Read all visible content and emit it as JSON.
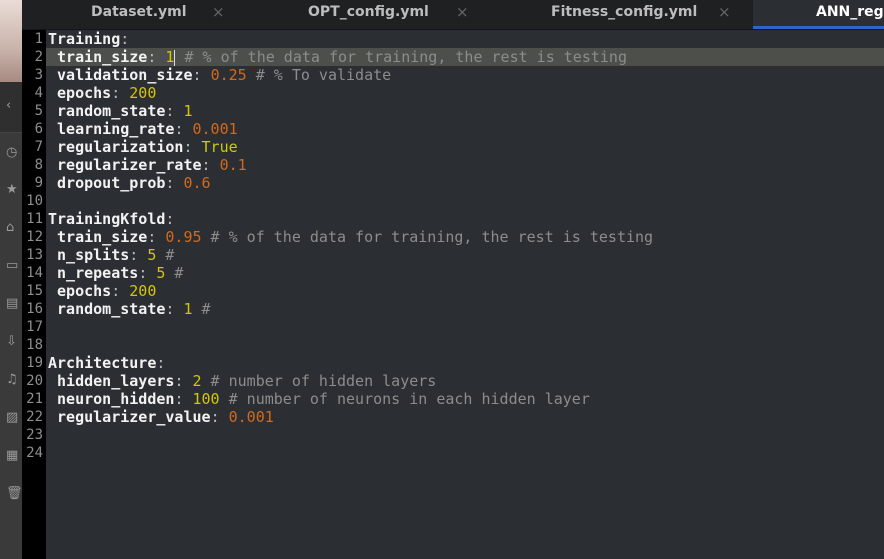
{
  "tabs": [
    {
      "label": "Dataset.yml",
      "active": false
    },
    {
      "label": "OPT_config.yml",
      "active": false
    },
    {
      "label": "Fitness_config.yml",
      "active": false
    },
    {
      "label": "ANN_reg.yml",
      "active": true
    }
  ],
  "close_glyph": "×",
  "line_numbers": [
    "1",
    "2",
    "3",
    "4",
    "5",
    "6",
    "7",
    "8",
    "9",
    "10",
    "11",
    "12",
    "13",
    "14",
    "15",
    "16",
    "17",
    "18",
    "19",
    "20",
    "21",
    "22",
    "23",
    "24"
  ],
  "lines": [
    {
      "indent": "",
      "key": "Training",
      "sep": ":",
      "val": "",
      "vt": "",
      "comment": ""
    },
    {
      "indent": " ",
      "key": "train_size",
      "sep": ": ",
      "val": "1",
      "vt": "i",
      "comment": " # % of the data for training, the rest is testing",
      "current": true
    },
    {
      "indent": " ",
      "key": "validation_size",
      "sep": ": ",
      "val": "0.25",
      "vt": "f",
      "comment": " # % To validate"
    },
    {
      "indent": " ",
      "key": "epochs",
      "sep": ": ",
      "val": "200",
      "vt": "i",
      "comment": ""
    },
    {
      "indent": " ",
      "key": "random_state",
      "sep": ": ",
      "val": "1",
      "vt": "i",
      "comment": ""
    },
    {
      "indent": " ",
      "key": "learning_rate",
      "sep": ": ",
      "val": "0.001",
      "vt": "f",
      "comment": ""
    },
    {
      "indent": " ",
      "key": "regularization",
      "sep": ": ",
      "val": "True",
      "vt": "b",
      "comment": ""
    },
    {
      "indent": " ",
      "key": "regularizer_rate",
      "sep": ": ",
      "val": "0.1",
      "vt": "f",
      "comment": ""
    },
    {
      "indent": " ",
      "key": "dropout_prob",
      "sep": ": ",
      "val": "0.6",
      "vt": "f",
      "comment": ""
    },
    {
      "indent": "",
      "key": "",
      "sep": "",
      "val": "",
      "vt": "",
      "comment": ""
    },
    {
      "indent": "",
      "key": "TrainingKfold",
      "sep": ":",
      "val": "",
      "vt": "",
      "comment": ""
    },
    {
      "indent": " ",
      "key": "train_size",
      "sep": ": ",
      "val": "0.95",
      "vt": "f",
      "comment": " # % of the data for training, the rest is testing"
    },
    {
      "indent": " ",
      "key": "n_splits",
      "sep": ": ",
      "val": "5",
      "vt": "i",
      "comment": " #"
    },
    {
      "indent": " ",
      "key": "n_repeats",
      "sep": ": ",
      "val": "5",
      "vt": "i",
      "comment": " #"
    },
    {
      "indent": " ",
      "key": "epochs",
      "sep": ": ",
      "val": "200",
      "vt": "i",
      "comment": ""
    },
    {
      "indent": " ",
      "key": "random_state",
      "sep": ": ",
      "val": "1",
      "vt": "i",
      "comment": " #"
    },
    {
      "indent": "",
      "key": "",
      "sep": "",
      "val": "",
      "vt": "",
      "comment": ""
    },
    {
      "indent": "",
      "key": "",
      "sep": "",
      "val": "",
      "vt": "",
      "comment": ""
    },
    {
      "indent": "",
      "key": "Architecture",
      "sep": ":",
      "val": "",
      "vt": "",
      "comment": ""
    },
    {
      "indent": " ",
      "key": "hidden_layers",
      "sep": ": ",
      "val": "2",
      "vt": "i",
      "comment": " # number of hidden layers"
    },
    {
      "indent": " ",
      "key": "neuron_hidden",
      "sep": ": ",
      "val": "100",
      "vt": "i",
      "comment": " # number of neurons in each hidden layer"
    },
    {
      "indent": " ",
      "key": "regularizer_value",
      "sep": ": ",
      "val": "0.001",
      "vt": "f",
      "comment": ""
    },
    {
      "indent": "",
      "key": "",
      "sep": "",
      "val": "",
      "vt": "",
      "comment": ""
    },
    {
      "indent": "",
      "key": "",
      "sep": "",
      "val": "",
      "vt": "",
      "comment": ""
    }
  ],
  "sidebar_icons": [
    "back-icon",
    "recent-icon",
    "starred-icon",
    "home-icon",
    "desktop-icon",
    "documents-icon",
    "downloads-icon",
    "music-icon",
    "pictures-icon",
    "videos-icon",
    "trash-icon"
  ]
}
